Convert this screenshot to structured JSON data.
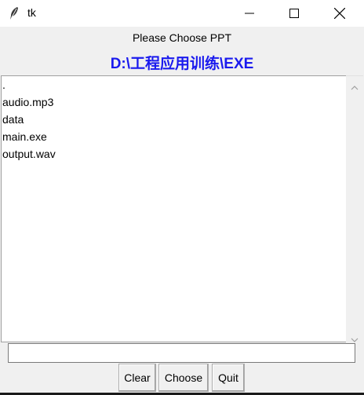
{
  "window": {
    "title": "tk",
    "icon": "feather-icon"
  },
  "prompt": "Please Choose PPT",
  "current_path": "D:\\工程应用训练\\EXE",
  "path_color": "#1a1aee",
  "list": {
    "items": [
      ".",
      "audio.mp3",
      "data",
      "main.exe",
      "output.wav"
    ]
  },
  "entry": {
    "value": ""
  },
  "buttons": {
    "clear": "Clear",
    "choose": "Choose",
    "quit": "Quit"
  }
}
